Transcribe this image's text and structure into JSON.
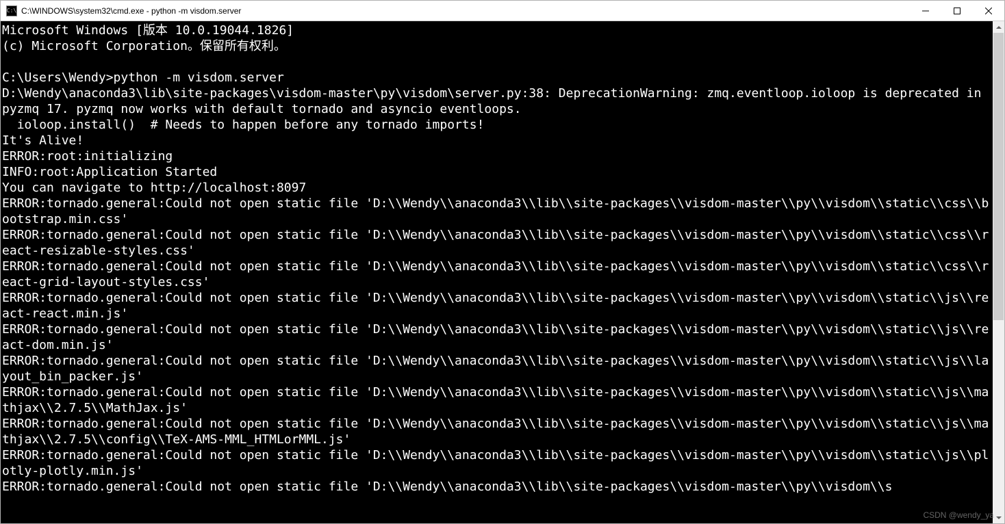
{
  "window": {
    "icon_text": "C:\\",
    "title": "C:\\WINDOWS\\system32\\cmd.exe - python  -m visdom.server"
  },
  "terminal": {
    "lines": [
      "Microsoft Windows [版本 10.0.19044.1826]",
      "(c) Microsoft Corporation。保留所有权利。",
      "",
      "C:\\Users\\Wendy>python -m visdom.server",
      "D:\\Wendy\\anaconda3\\lib\\site-packages\\visdom-master\\py\\visdom\\server.py:38: DeprecationWarning: zmq.eventloop.ioloop is deprecated in pyzmq 17. pyzmq now works with default tornado and asyncio eventloops.",
      "  ioloop.install()  # Needs to happen before any tornado imports!",
      "It's Alive!",
      "ERROR:root:initializing",
      "INFO:root:Application Started",
      "You can navigate to http://localhost:8097",
      "ERROR:tornado.general:Could not open static file 'D:\\\\Wendy\\\\anaconda3\\\\lib\\\\site-packages\\\\visdom-master\\\\py\\\\visdom\\\\static\\\\css\\\\bootstrap.min.css'",
      "ERROR:tornado.general:Could not open static file 'D:\\\\Wendy\\\\anaconda3\\\\lib\\\\site-packages\\\\visdom-master\\\\py\\\\visdom\\\\static\\\\css\\\\react-resizable-styles.css'",
      "ERROR:tornado.general:Could not open static file 'D:\\\\Wendy\\\\anaconda3\\\\lib\\\\site-packages\\\\visdom-master\\\\py\\\\visdom\\\\static\\\\css\\\\react-grid-layout-styles.css'",
      "ERROR:tornado.general:Could not open static file 'D:\\\\Wendy\\\\anaconda3\\\\lib\\\\site-packages\\\\visdom-master\\\\py\\\\visdom\\\\static\\\\js\\\\react-react.min.js'",
      "ERROR:tornado.general:Could not open static file 'D:\\\\Wendy\\\\anaconda3\\\\lib\\\\site-packages\\\\visdom-master\\\\py\\\\visdom\\\\static\\\\js\\\\react-dom.min.js'",
      "ERROR:tornado.general:Could not open static file 'D:\\\\Wendy\\\\anaconda3\\\\lib\\\\site-packages\\\\visdom-master\\\\py\\\\visdom\\\\static\\\\js\\\\layout_bin_packer.js'",
      "ERROR:tornado.general:Could not open static file 'D:\\\\Wendy\\\\anaconda3\\\\lib\\\\site-packages\\\\visdom-master\\\\py\\\\visdom\\\\static\\\\js\\\\mathjax\\\\2.7.5\\\\MathJax.js'",
      "ERROR:tornado.general:Could not open static file 'D:\\\\Wendy\\\\anaconda3\\\\lib\\\\site-packages\\\\visdom-master\\\\py\\\\visdom\\\\static\\\\js\\\\mathjax\\\\2.7.5\\\\config\\\\TeX-AMS-MML_HTMLorMML.js'",
      "ERROR:tornado.general:Could not open static file 'D:\\\\Wendy\\\\anaconda3\\\\lib\\\\site-packages\\\\visdom-master\\\\py\\\\visdom\\\\static\\\\js\\\\plotly-plotly.min.js'",
      "ERROR:tornado.general:Could not open static file 'D:\\\\Wendy\\\\anaconda3\\\\lib\\\\site-packages\\\\visdom-master\\\\py\\\\visdom\\\\s"
    ]
  },
  "watermark": "CSDN @wendy_ya"
}
